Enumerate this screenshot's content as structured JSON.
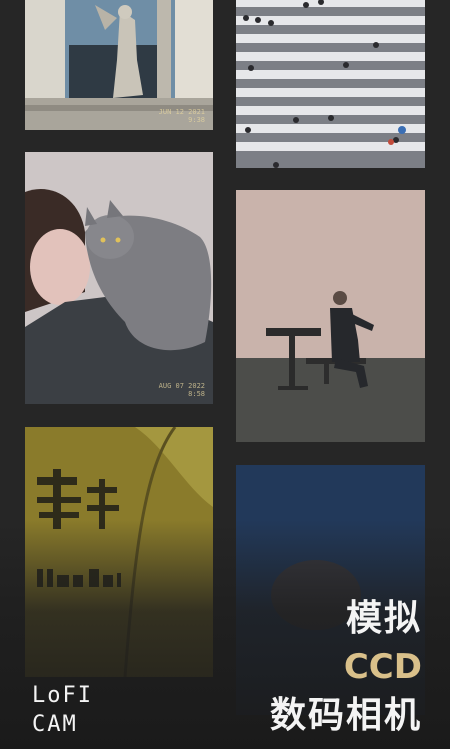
{
  "feed": {
    "photos": [
      {
        "subject": "statue-building",
        "stamp": [
          "JUN 12 2021",
          "9:38"
        ]
      },
      {
        "subject": "crosswalk-aerial"
      },
      {
        "subject": "woman-with-cat",
        "stamp": [
          "AUG 07 2022",
          "8:58"
        ]
      },
      {
        "subject": "man-on-bench"
      },
      {
        "subject": "wan-chai-sign"
      },
      {
        "subject": "night-blue"
      }
    ]
  },
  "tagline": {
    "line1": "模拟",
    "line2": "CCD",
    "line3": "数码相机"
  },
  "logo": {
    "line1": "LoFI",
    "line2": "CAM"
  },
  "colors": {
    "background": "#262626",
    "accent_gold": "#d9c08a",
    "text_white": "#f4f4f4"
  }
}
